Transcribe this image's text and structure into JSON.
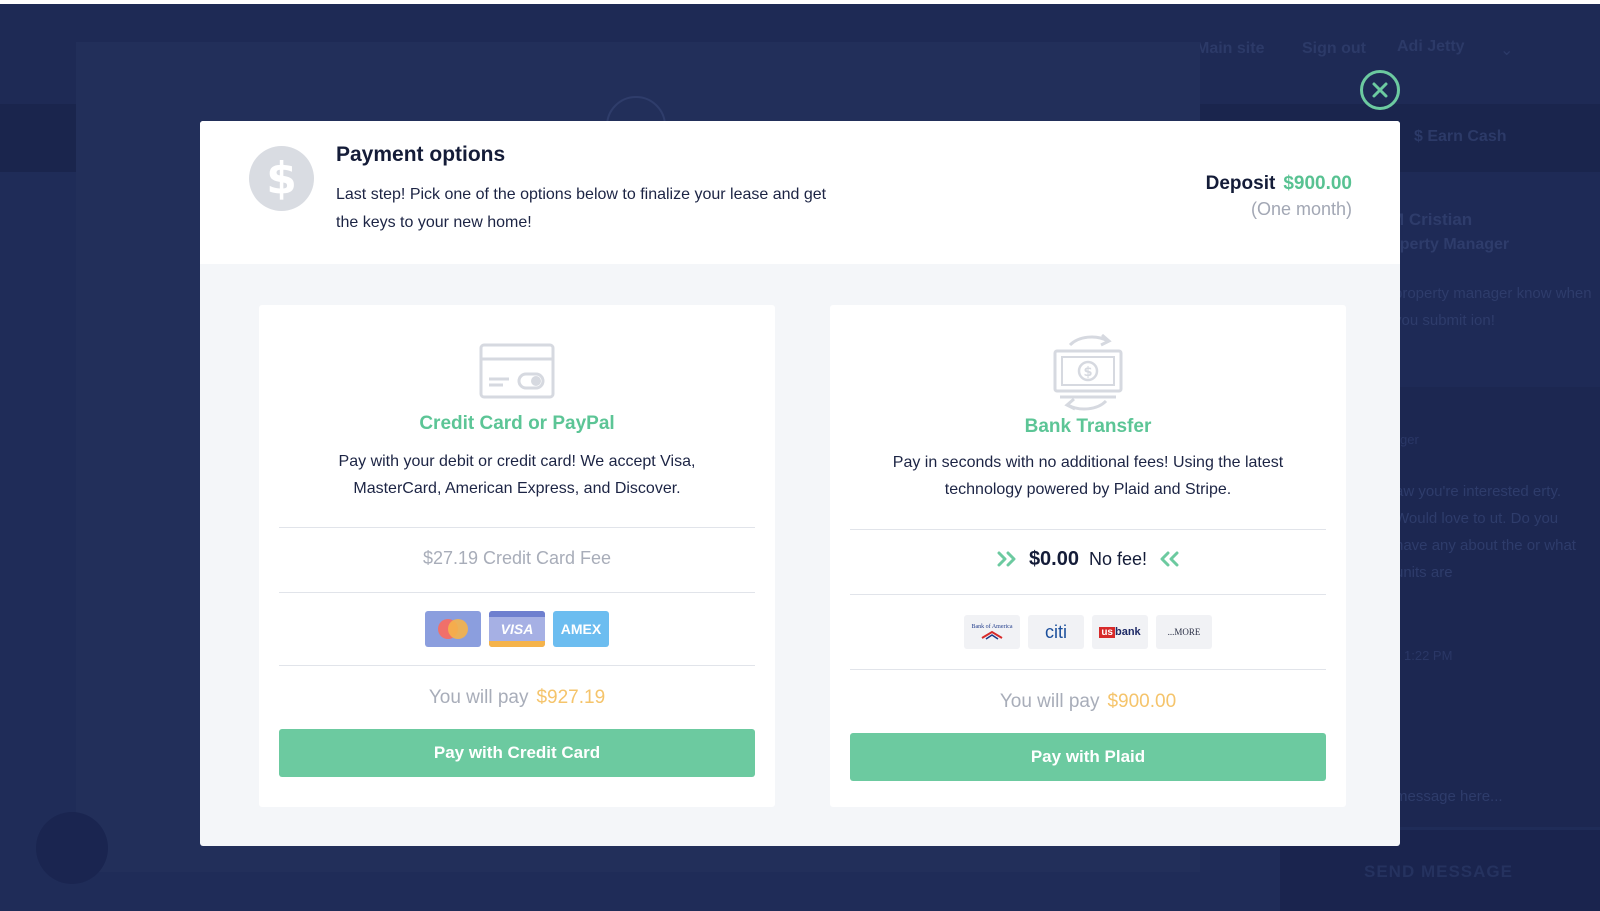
{
  "background": {
    "nav": {
      "main_site": "Main site",
      "sign_out": "Sign out",
      "user_name": "Adi Jetty"
    },
    "earn_cash": "$ Earn Cash",
    "manager": {
      "name": "M Cristian",
      "role": "operty Manager",
      "note": "property manager know when you submit ion!"
    },
    "chat": {
      "sender": "ger",
      "message": "aw you're interested erty. Would love to ut. Do you have any about the or what units are",
      "time": "1:22 PM",
      "input_placeholder": "message here...",
      "send_label": "SEND MESSAGE"
    }
  },
  "modal": {
    "icon": "dollar-icon",
    "title": "Payment options",
    "description": "Last step! Pick one of the options below to finalize your lease and get the keys to your new home!",
    "deposit_label": "Deposit",
    "deposit_amount": "$900.00",
    "deposit_period": "(One month)"
  },
  "options": {
    "credit": {
      "icon": "credit-card-icon",
      "title": "Credit Card or PayPal",
      "description": "Pay with your debit or credit card! We accept Visa, MasterCard, American Express, and Discover.",
      "fee_text": "$27.19 Credit Card Fee",
      "logos": {
        "mastercard": "mastercard-logo",
        "visa": "VISA",
        "amex": "AMEX"
      },
      "you_pay_label": "You will pay",
      "you_pay_amount": "$927.19",
      "button_label": "Pay with Credit Card"
    },
    "bank": {
      "icon": "bank-transfer-icon",
      "title": "Bank Transfer",
      "description": "Pay in seconds with no additional fees! Using the latest technology powered by Plaid and Stripe.",
      "fee_amount": "$0.00",
      "fee_free": "No fee!",
      "logos": {
        "boa": "Bank of America",
        "citi": "citi",
        "usbank": "bank",
        "usbank_prefix": "us",
        "more": "...MORE"
      },
      "you_pay_label": "You will pay",
      "you_pay_amount": "$900.00",
      "button_label": "Pay with Plaid"
    }
  },
  "colors": {
    "accent_green": "#6ccaa0",
    "title_green": "#5cc596",
    "amount_yellow": "#f5c46b",
    "overlay_navy": "#1f2c58"
  }
}
